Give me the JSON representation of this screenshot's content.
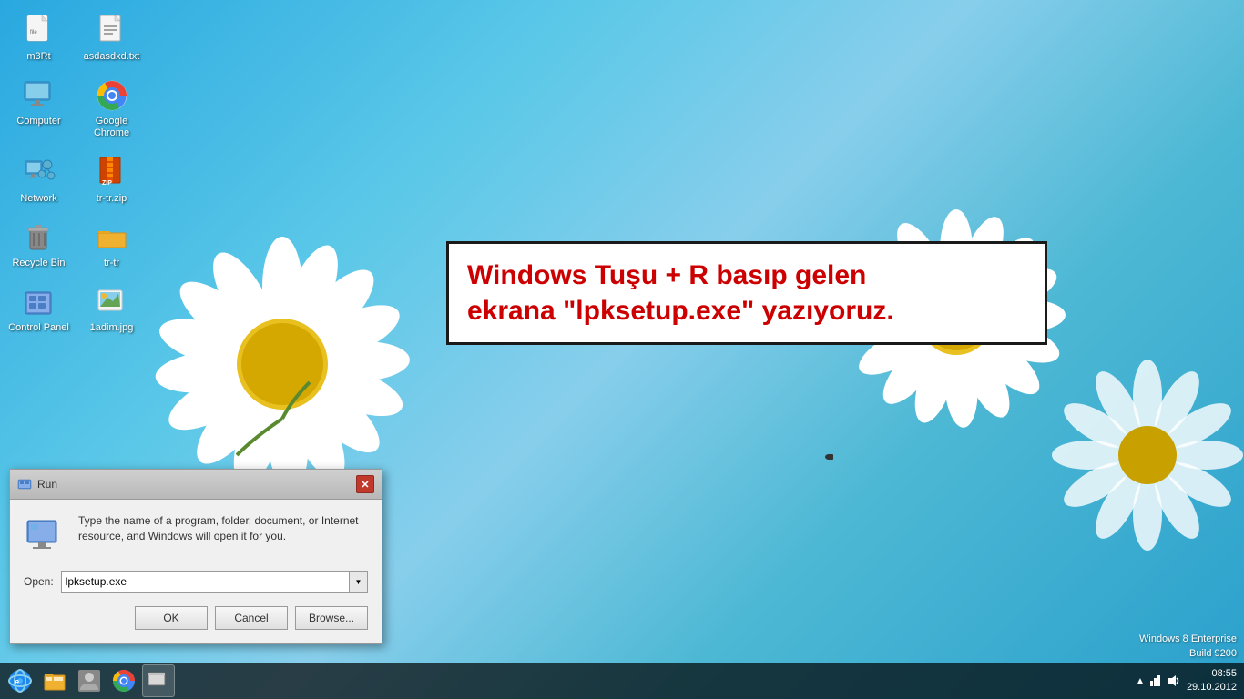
{
  "desktop": {
    "background_color": "#4ab8d8"
  },
  "icons": [
    {
      "id": "m3rt",
      "label": "m3Rt",
      "row": 0,
      "col": 0,
      "type": "file"
    },
    {
      "id": "asdasdxd",
      "label": "asdasdxd.txt",
      "row": 0,
      "col": 1,
      "type": "text"
    },
    {
      "id": "computer",
      "label": "Computer",
      "row": 1,
      "col": 0,
      "type": "computer"
    },
    {
      "id": "google-chrome",
      "label": "Google Chrome",
      "row": 1,
      "col": 1,
      "type": "chrome"
    },
    {
      "id": "network",
      "label": "Network",
      "row": 2,
      "col": 0,
      "type": "network"
    },
    {
      "id": "tr-tr-zip",
      "label": "tr-tr.zip",
      "row": 2,
      "col": 1,
      "type": "zip"
    },
    {
      "id": "recycle-bin",
      "label": "Recycle Bin",
      "row": 3,
      "col": 0,
      "type": "recycle"
    },
    {
      "id": "tr-tr",
      "label": "tr-tr",
      "row": 3,
      "col": 1,
      "type": "folder"
    },
    {
      "id": "control-panel",
      "label": "Control Panel",
      "row": 4,
      "col": 0,
      "type": "control"
    },
    {
      "id": "1adim",
      "label": "1adim.jpg",
      "row": 4,
      "col": 1,
      "type": "image"
    }
  ],
  "annotation": {
    "text_line1": "Windows Tuşu + R basıp gelen",
    "text_line2": "ekrana \"lpksetup.exe\" yazıyoruz."
  },
  "run_dialog": {
    "title": "Run",
    "description": "Type the name of a program, folder, document, or Internet resource, and Windows will open it for you.",
    "open_label": "Open:",
    "input_value": "lpksetup.exe",
    "ok_label": "OK",
    "cancel_label": "Cancel",
    "browse_label": "Browse..."
  },
  "taskbar": {
    "icons": [
      {
        "id": "ie",
        "label": "Internet Explorer"
      },
      {
        "id": "explorer",
        "label": "File Explorer"
      },
      {
        "id": "user",
        "label": "User"
      },
      {
        "id": "chrome",
        "label": "Google Chrome"
      },
      {
        "id": "run",
        "label": "Run"
      }
    ]
  },
  "system": {
    "time": "08:55",
    "date": "29.10.2012",
    "windows_version": "Windows 8 Enterprise",
    "build": "Build 9200"
  }
}
